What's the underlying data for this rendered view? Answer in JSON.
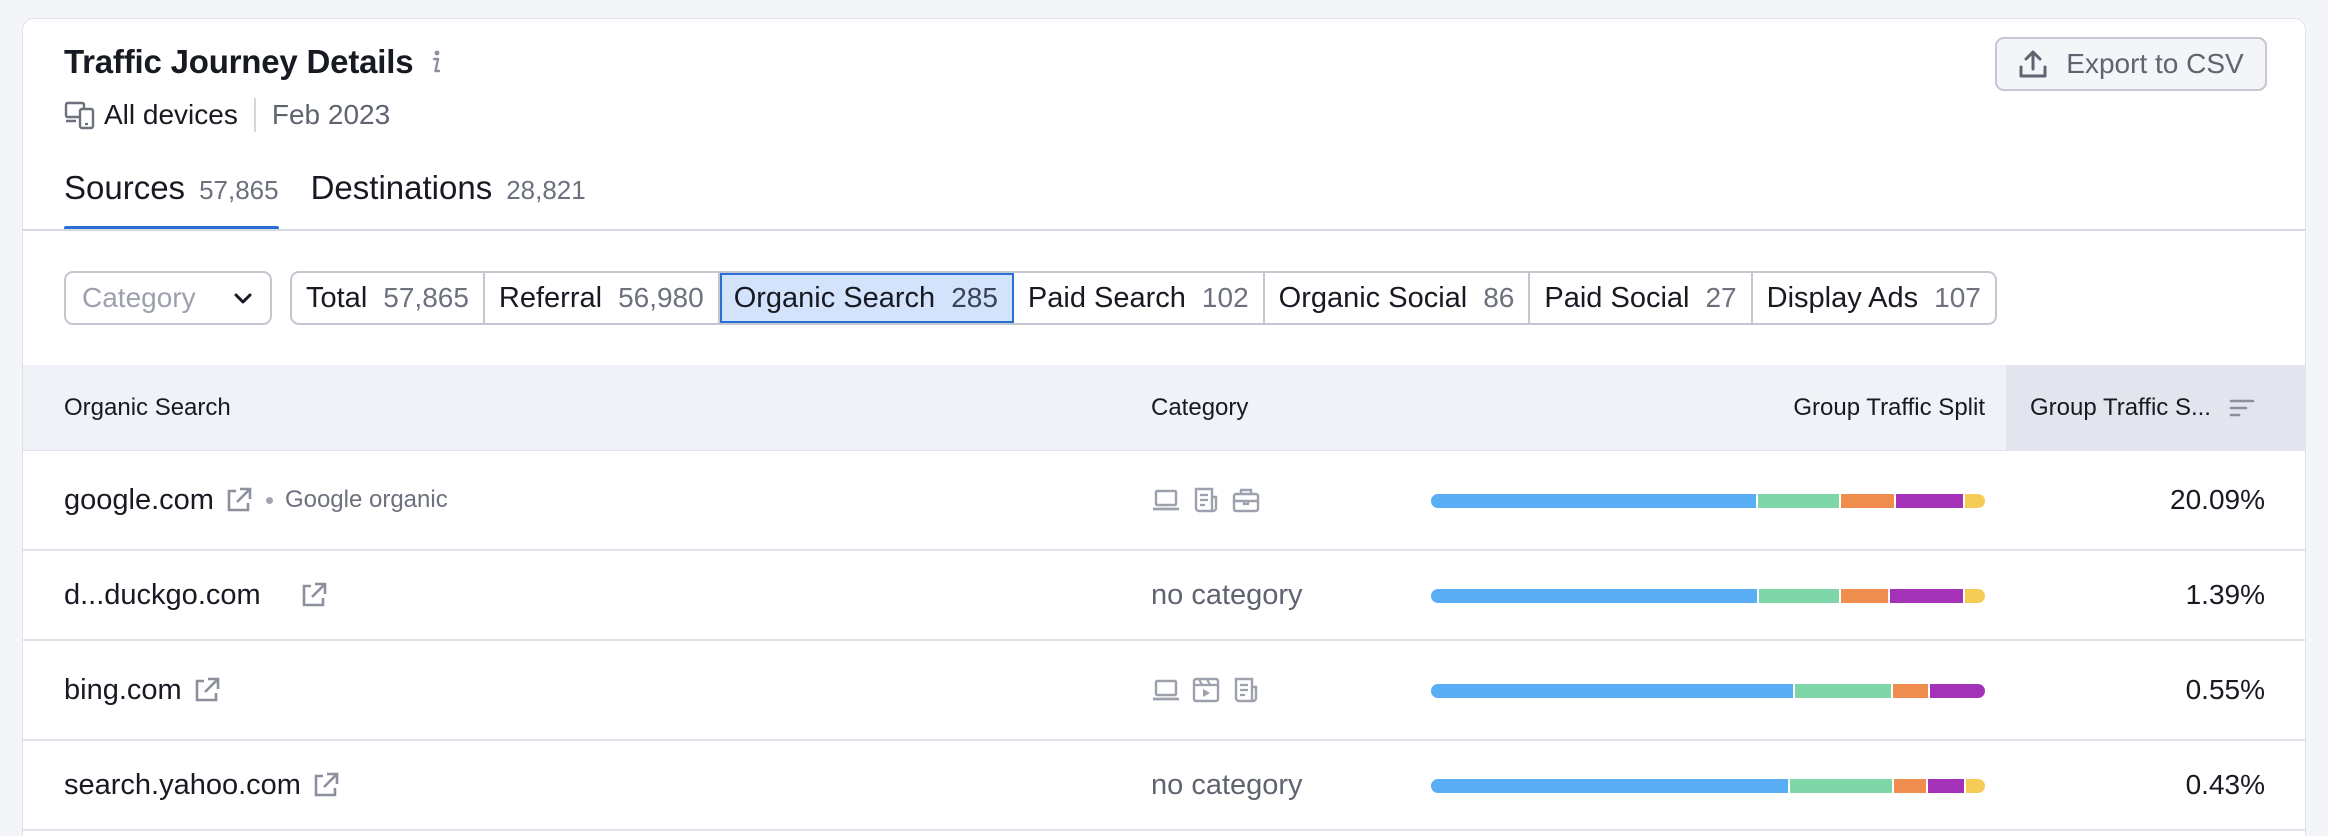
{
  "header": {
    "title": "Traffic Journey Details",
    "info_icon": "info-icon",
    "devices_icon": "devices-icon",
    "devices": "All devices",
    "date": "Feb 2023",
    "export_label": "Export to CSV",
    "export_icon": "upload-icon"
  },
  "tabs": [
    {
      "label": "Sources",
      "count": "57,865",
      "active": true
    },
    {
      "label": "Destinations",
      "count": "28,821",
      "active": false
    }
  ],
  "filters": {
    "category_placeholder": "Category",
    "chips": [
      {
        "label": "Total",
        "count": "57,865",
        "selected": false
      },
      {
        "label": "Referral",
        "count": "56,980",
        "selected": false
      },
      {
        "label": "Organic Search",
        "count": "285",
        "selected": true
      },
      {
        "label": "Paid Search",
        "count": "102",
        "selected": false
      },
      {
        "label": "Organic Social",
        "count": "86",
        "selected": false
      },
      {
        "label": "Paid Social",
        "count": "27",
        "selected": false
      },
      {
        "label": "Display Ads",
        "count": "107",
        "selected": false
      }
    ]
  },
  "table": {
    "columns": {
      "source": "Organic Search",
      "category": "Category",
      "split": "Group Traffic Split",
      "share": "Group Traffic S..."
    },
    "colors": {
      "blue": "#5aaef5",
      "green": "#7fd6a9",
      "orange": "#ef8d4f",
      "purple": "#a332b8",
      "yellow": "#f4cc56"
    },
    "rows": [
      {
        "domain": "google.com",
        "sub": "Google organic",
        "category": "",
        "category_icons": [
          "laptop-icon",
          "news-icon",
          "briefcase-icon"
        ],
        "split": [
          0.595,
          0.148,
          0.097,
          0.123,
          0.037
        ],
        "share": "20.09%"
      },
      {
        "domain": "d...duckgo.com",
        "sub": "",
        "category": "no category",
        "category_icons": [],
        "split": [
          0.597,
          0.147,
          0.086,
          0.134,
          0.036
        ],
        "share": "1.39%"
      },
      {
        "domain": "bing.com",
        "sub": "",
        "category": "",
        "category_icons": [
          "laptop-icon",
          "video-icon",
          "news-icon"
        ],
        "split": [
          0.66,
          0.175,
          0.065,
          0.1,
          0
        ],
        "share": "0.55%"
      },
      {
        "domain": "search.yahoo.com",
        "sub": "",
        "category": "no category",
        "category_icons": [],
        "split": [
          0.653,
          0.187,
          0.06,
          0.065,
          0.035
        ],
        "share": "0.43%"
      }
    ]
  }
}
